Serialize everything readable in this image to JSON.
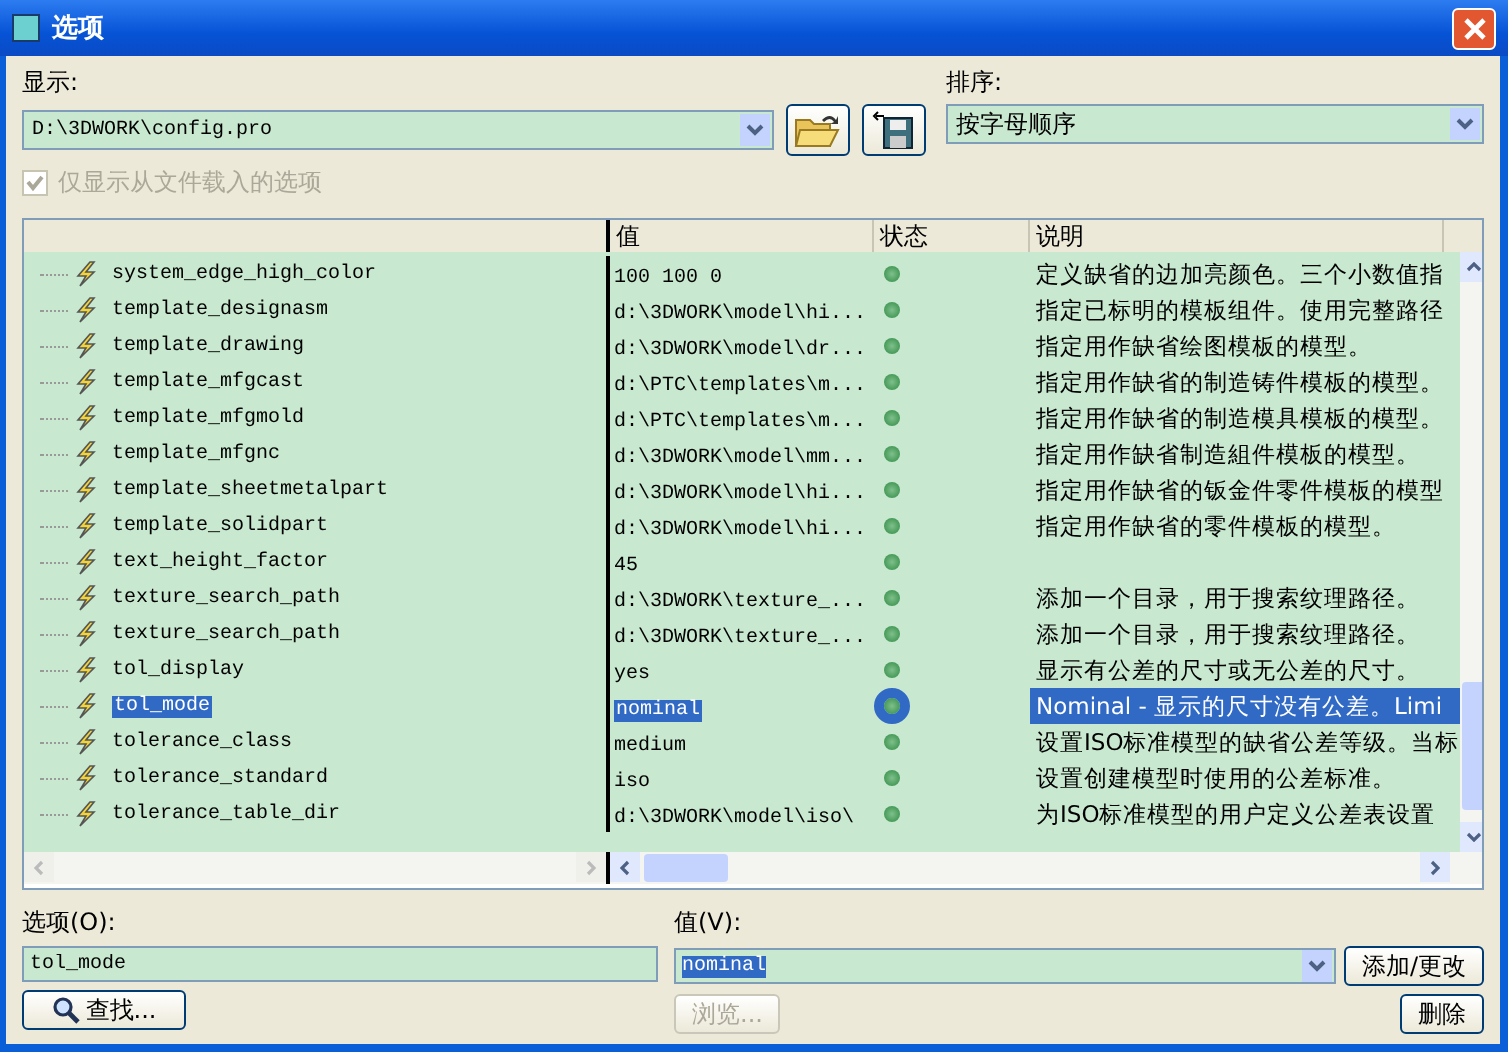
{
  "window": {
    "title": "选项"
  },
  "display": {
    "label": "显示:",
    "value": "D:\\3DWORK\\config.pro"
  },
  "sort": {
    "label": "排序:",
    "value": "按字母顺序"
  },
  "loaded_only": {
    "label": "仅显示从文件载入的选项",
    "checked": true,
    "disabled": true
  },
  "table": {
    "columns": [
      "值",
      "状态",
      "说明"
    ],
    "rows": [
      {
        "name": "system_edge_high_color",
        "value": "100 100 0",
        "description": "定义缺省的边加亮颜色。三个小数值指",
        "selected": false
      },
      {
        "name": "template_designasm",
        "value": "d:\\3DWORK\\model\\hi...",
        "description": "指定已标明的模板组件。使用完整路径",
        "selected": false
      },
      {
        "name": "template_drawing",
        "value": "d:\\3DWORK\\model\\dr...",
        "description": "指定用作缺省绘图模板的模型。",
        "selected": false
      },
      {
        "name": "template_mfgcast",
        "value": "d:\\PTC\\templates\\m...",
        "description": "指定用作缺省的制造铸件模板的模型。",
        "selected": false
      },
      {
        "name": "template_mfgmold",
        "value": "d:\\PTC\\templates\\m...",
        "description": "指定用作缺省的制造模具模板的模型。",
        "selected": false
      },
      {
        "name": "template_mfgnc",
        "value": "d:\\3DWORK\\model\\mm...",
        "description": "指定用作缺省制造組件模板的模型。",
        "selected": false
      },
      {
        "name": "template_sheetmetalpart",
        "value": "d:\\3DWORK\\model\\hi...",
        "description": "指定用作缺省的钣金件零件模板的模型",
        "selected": false
      },
      {
        "name": "template_solidpart",
        "value": "d:\\3DWORK\\model\\hi...",
        "description": "指定用作缺省的零件模板的模型。",
        "selected": false
      },
      {
        "name": "text_height_factor",
        "value": "45",
        "selected": false
      },
      {
        "name": "texture_search_path",
        "value": "d:\\3DWORK\\texture_...",
        "description": "添加一个目录，用于搜索纹理路径。",
        "selected": false
      },
      {
        "name": "texture_search_path",
        "value": "d:\\3DWORK\\texture_...",
        "description": "添加一个目录，用于搜索纹理路径。",
        "selected": false
      },
      {
        "name": "tol_display",
        "value": "yes",
        "description": "显示有公差的尺寸或无公差的尺寸。",
        "selected": false
      },
      {
        "name": "tol_mode",
        "value": "nominal",
        "description": "Nominal - 显示的尺寸没有公差。Limi",
        "selected": true
      },
      {
        "name": "tolerance_class",
        "value": "medium",
        "description": "设置ISO标准模型的缺省公差等级。当标",
        "selected": false
      },
      {
        "name": "tolerance_standard",
        "value": "iso",
        "description": "设置创建模型时使用的公差标准。",
        "selected": false
      },
      {
        "name": "tolerance_table_dir",
        "value": "d:\\3DWORK\\model\\iso\\",
        "description": "为ISO标准模型的用户定义公差表设置",
        "selected": false
      }
    ]
  },
  "option_field": {
    "label": "选项(O):",
    "value": "tol_mode"
  },
  "value_field": {
    "label": "值(V):",
    "value": "nominal"
  },
  "buttons": [
    {
      "kind": "find",
      "label": "查找...",
      "disabled": false
    },
    {
      "kind": "browse",
      "label": "浏览...",
      "disabled": true
    },
    {
      "kind": "add",
      "label": "添加/更改",
      "disabled": false
    },
    {
      "kind": "delete",
      "label": "删除",
      "disabled": false
    }
  ]
}
